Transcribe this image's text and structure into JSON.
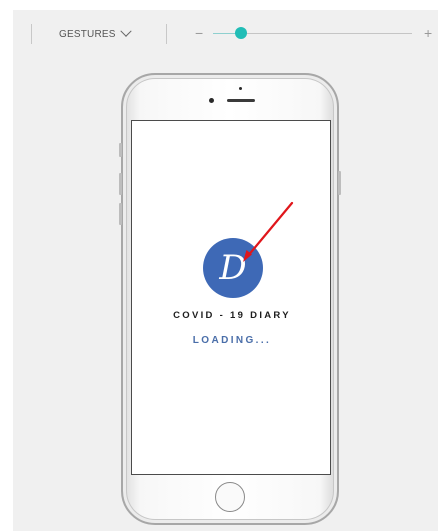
{
  "toolbar": {
    "gestures_label": "GESTURES",
    "zoom_minus_symbol": "−",
    "zoom_plus_symbol": "+",
    "zoom_level": 0.14
  },
  "app_screen": {
    "logo_letter": "D",
    "app_name": "COVID - 19 DIARY",
    "status_text": "LOADING..."
  },
  "colors": {
    "canvas_bg": "#f0f0f0",
    "slider_thumb": "#21bdb6",
    "logo_bg": "#3e69b6",
    "loading_text": "#4a6ea9",
    "annotation_arrow": "#e0161b"
  },
  "icons": {
    "gestures_dropdown": "chevron-down-icon",
    "annotation": "red-arrow-icon"
  }
}
